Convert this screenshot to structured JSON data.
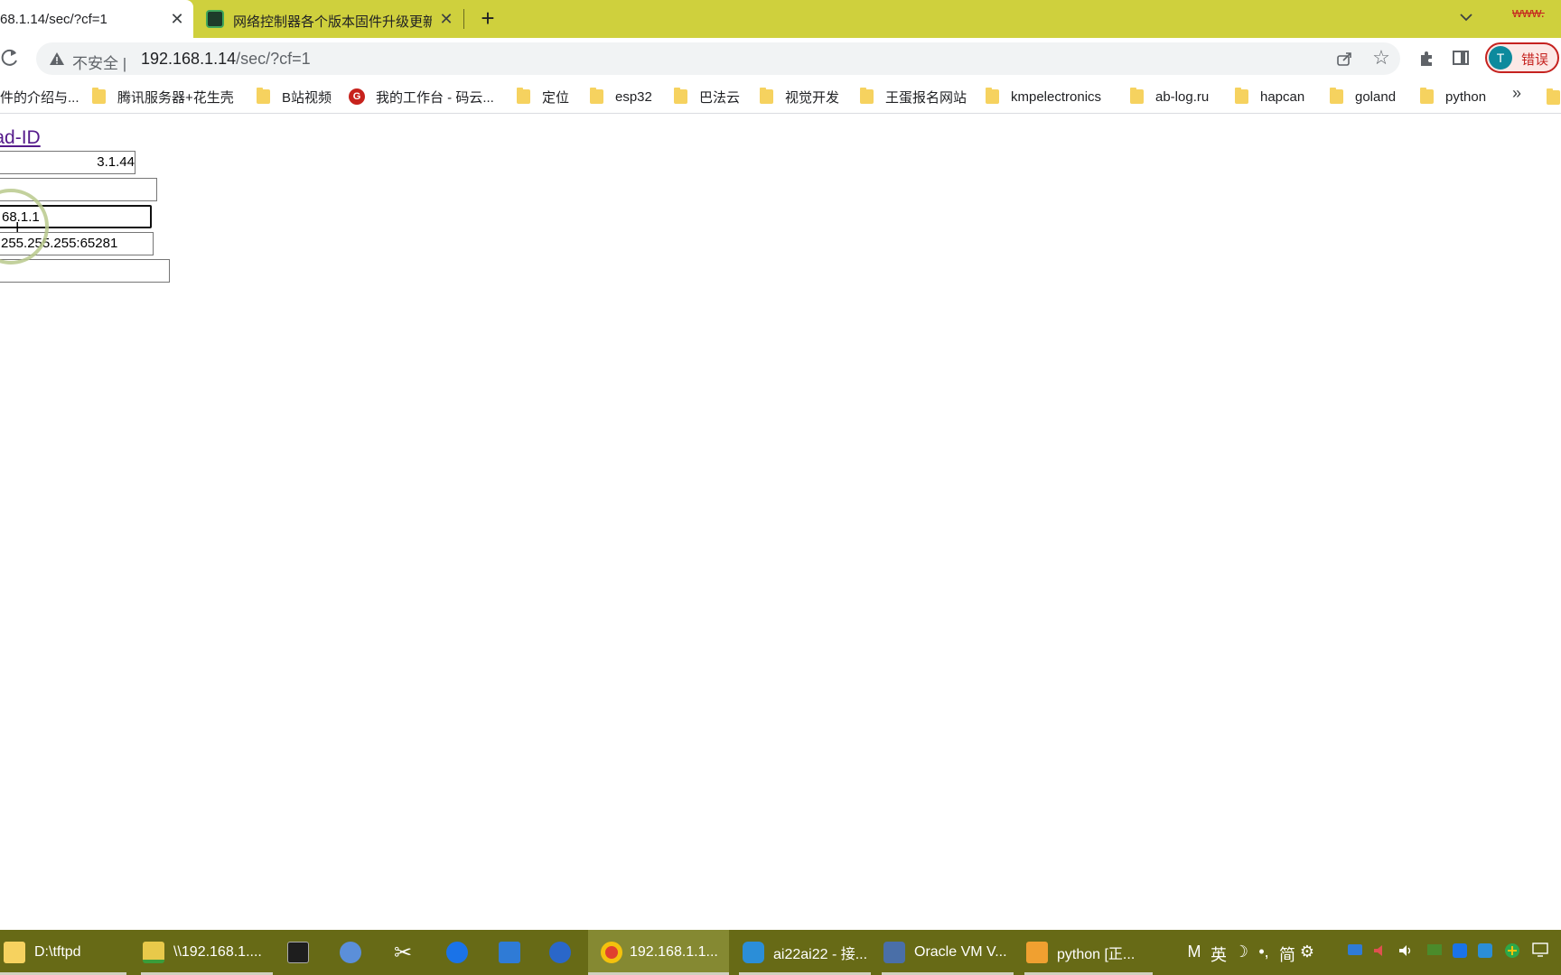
{
  "browser": {
    "tabs": [
      {
        "title": "68.1.14/sec/?cf=1",
        "active": true
      },
      {
        "title": "网络控制器各个版本固件升级更新",
        "active": false
      }
    ],
    "corner_text": "www.",
    "address": {
      "security_label": "不安全 |",
      "url_host": "192.168.1.14",
      "url_path": "/sec/?cf=1"
    },
    "profile": {
      "avatar_letter": "T",
      "status_label": "错误",
      "accent": "#c5221f"
    },
    "bookmarks": [
      {
        "label": "件的介绍与...",
        "icon": "none"
      },
      {
        "label": "腾讯服务器+花生壳",
        "icon": "folder"
      },
      {
        "label": "B站视频",
        "icon": "folder"
      },
      {
        "label": "我的工作台 - 码云...",
        "icon": "gitee-icon"
      },
      {
        "label": "定位",
        "icon": "folder"
      },
      {
        "label": "esp32",
        "icon": "folder"
      },
      {
        "label": "巴法云",
        "icon": "folder"
      },
      {
        "label": "视觉开发",
        "icon": "folder"
      },
      {
        "label": "王蛋报名网站",
        "icon": "folder"
      },
      {
        "label": "kmpelectronics",
        "icon": "folder"
      },
      {
        "label": "ab-log.ru",
        "icon": "folder"
      },
      {
        "label": "hapcan",
        "icon": "folder"
      },
      {
        "label": "goland",
        "icon": "folder"
      },
      {
        "label": "python",
        "icon": "folder"
      }
    ],
    "bookmarks_more": "»"
  },
  "page": {
    "link_text": "egad-ID",
    "fields": [
      {
        "value": "3.1.44"
      },
      {
        "value": ""
      },
      {
        "value": "68.1.1"
      },
      {
        "value": "255.255.255:65281"
      },
      {
        "value": ""
      }
    ]
  },
  "taskbar": {
    "items": [
      {
        "label": "D:\\tftpd",
        "icon": "folder-icon"
      },
      {
        "label": "\\\\192.168.1....",
        "icon": "network-folder-icon"
      },
      {
        "label": "",
        "icon": "terminal-icon"
      },
      {
        "label": "",
        "icon": "network-icon"
      },
      {
        "label": "",
        "icon": "scissors-icon"
      },
      {
        "label": "",
        "icon": "edge-icon"
      },
      {
        "label": "",
        "icon": "camera-icon"
      },
      {
        "label": "",
        "icon": "feather-icon"
      },
      {
        "label": "192.168.1.1...",
        "icon": "chrome-icon"
      },
      {
        "label": "ai22ai22 - 接...",
        "icon": "q-icon"
      },
      {
        "label": "Oracle VM V...",
        "icon": "virtualbox-icon"
      },
      {
        "label": "python [正...",
        "icon": "pycharm-icon"
      }
    ],
    "ime": {
      "mode_m": "M",
      "lang": "英",
      "moon": "☽",
      "punct": "•,",
      "charset": "简",
      "settings": "⚙"
    }
  }
}
